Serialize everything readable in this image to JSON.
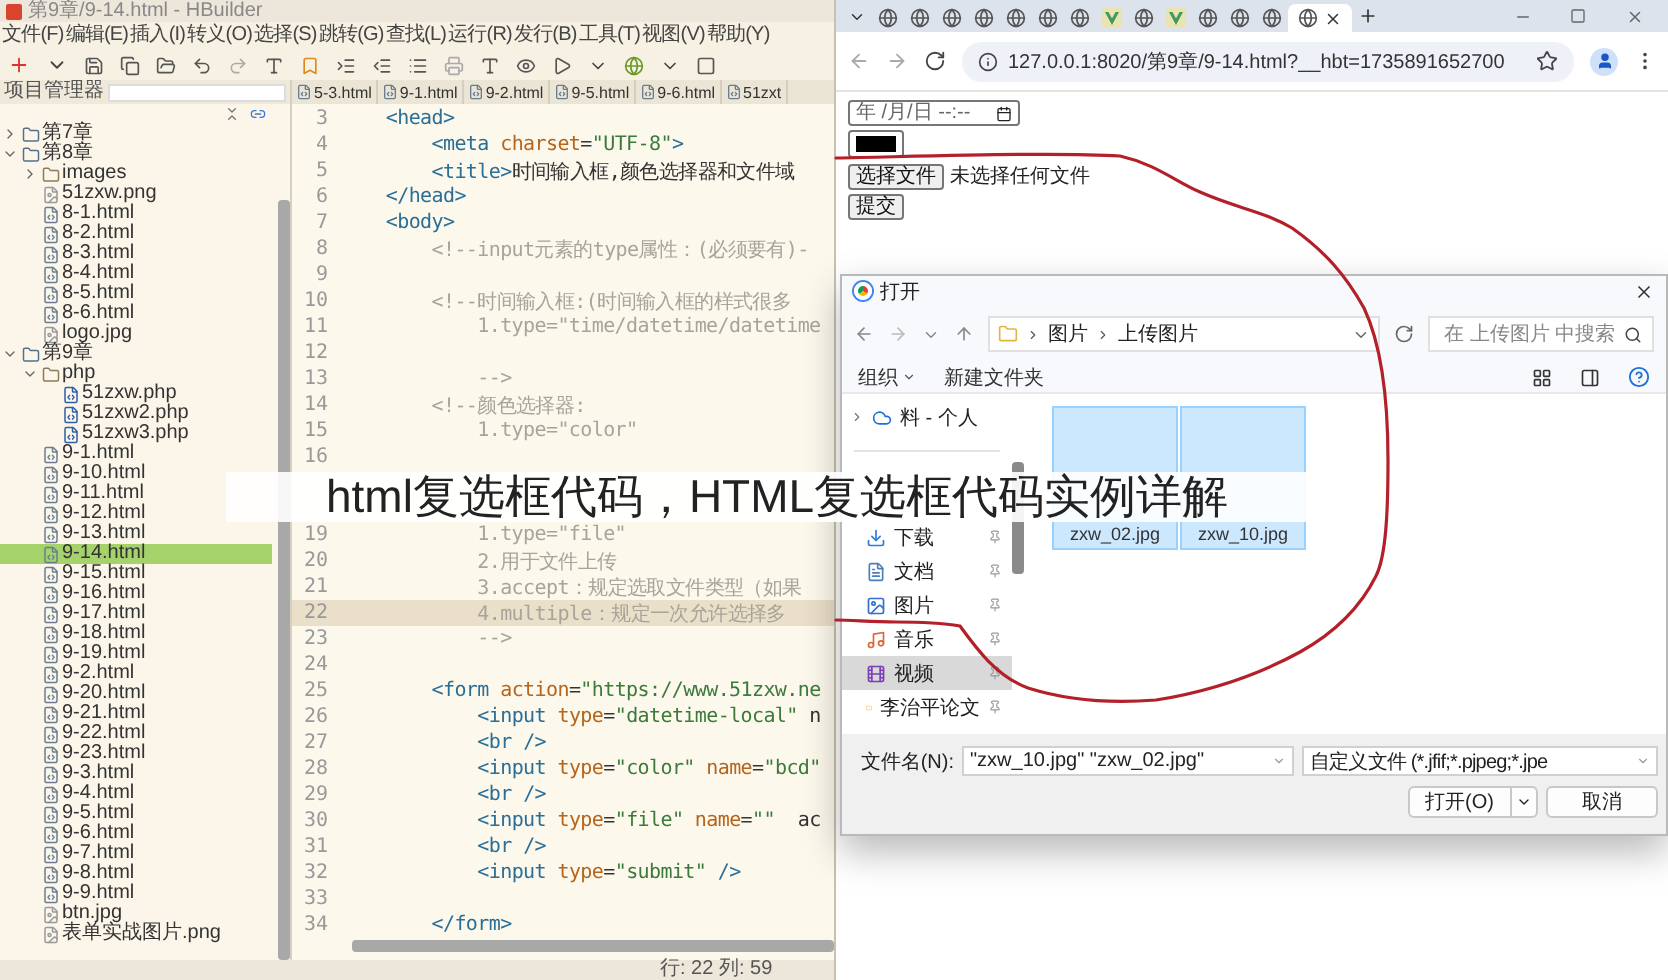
{
  "editor_window": {
    "title": "第9章/9-14.html - HBuilder",
    "menu": [
      "文件(F)",
      "编辑(E)",
      "插入(I)",
      "转义(O)",
      "选择(S)",
      "跳转(G)",
      "查找(L)",
      "运行(R)",
      "发行(B)",
      "工具(T)",
      "视图(V)",
      "帮助(Y)"
    ],
    "project_panel": {
      "title": "项目管理器",
      "tree": [
        {
          "label": "第7章",
          "kind": "chapter",
          "expanded": false,
          "selected": false
        },
        {
          "label": "第8章",
          "kind": "chapter",
          "expanded": true,
          "selected": false,
          "children": [
            {
              "label": "images",
              "kind": "folder",
              "expanded": false,
              "selected": false
            },
            {
              "label": "51zxw.png",
              "kind": "image",
              "selected": false
            },
            {
              "label": "8-1.html",
              "kind": "html",
              "selected": false
            },
            {
              "label": "8-2.html",
              "kind": "html",
              "selected": false
            },
            {
              "label": "8-3.html",
              "kind": "html",
              "selected": false
            },
            {
              "label": "8-4.html",
              "kind": "html",
              "selected": false
            },
            {
              "label": "8-5.html",
              "kind": "html",
              "selected": false
            },
            {
              "label": "8-6.html",
              "kind": "html",
              "selected": false
            },
            {
              "label": "logo.jpg",
              "kind": "image",
              "selected": false
            }
          ]
        },
        {
          "label": "第9章",
          "kind": "chapter",
          "expanded": true,
          "selected": false,
          "children": [
            {
              "label": "php",
              "kind": "folder",
              "expanded": true,
              "selected": false,
              "children": [
                {
                  "label": "51zxw.php",
                  "kind": "php",
                  "selected": false
                },
                {
                  "label": "51zxw2.php",
                  "kind": "php",
                  "selected": false
                },
                {
                  "label": "51zxw3.php",
                  "kind": "php",
                  "selected": false
                }
              ]
            },
            {
              "label": "9-1.html",
              "kind": "html",
              "selected": false
            },
            {
              "label": "9-10.html",
              "kind": "html",
              "selected": false
            },
            {
              "label": "9-11.html",
              "kind": "html",
              "selected": false
            },
            {
              "label": "9-12.html",
              "kind": "html",
              "selected": false
            },
            {
              "label": "9-13.html",
              "kind": "html",
              "selected": false
            },
            {
              "label": "9-14.html",
              "kind": "html",
              "selected": true
            },
            {
              "label": "9-15.html",
              "kind": "html",
              "selected": false
            },
            {
              "label": "9-16.html",
              "kind": "html",
              "selected": false
            },
            {
              "label": "9-17.html",
              "kind": "html",
              "selected": false
            },
            {
              "label": "9-18.html",
              "kind": "html",
              "selected": false
            },
            {
              "label": "9-19.html",
              "kind": "html",
              "selected": false
            },
            {
              "label": "9-2.html",
              "kind": "html",
              "selected": false
            },
            {
              "label": "9-20.html",
              "kind": "html",
              "selected": false
            },
            {
              "label": "9-21.html",
              "kind": "html",
              "selected": false
            },
            {
              "label": "9-22.html",
              "kind": "html",
              "selected": false
            },
            {
              "label": "9-23.html",
              "kind": "html",
              "selected": false
            },
            {
              "label": "9-3.html",
              "kind": "html",
              "selected": false
            },
            {
              "label": "9-4.html",
              "kind": "html",
              "selected": false
            },
            {
              "label": "9-5.html",
              "kind": "html",
              "selected": false
            },
            {
              "label": "9-6.html",
              "kind": "html",
              "selected": false
            },
            {
              "label": "9-7.html",
              "kind": "html",
              "selected": false
            },
            {
              "label": "9-8.html",
              "kind": "html",
              "selected": false
            },
            {
              "label": "9-9.html",
              "kind": "html",
              "selected": false
            },
            {
              "label": "btn.jpg",
              "kind": "image",
              "selected": false
            },
            {
              "label": "表单实战图片.png",
              "kind": "image",
              "selected": false
            }
          ]
        }
      ]
    },
    "editor_tabs": [
      "5-3.html",
      "9-1.html",
      "9-2.html",
      "9-5.html",
      "9-6.html",
      "51zxt"
    ],
    "code_lines": [
      {
        "number": "3",
        "kind": "markup",
        "text": "    <head>",
        "highlighted": false
      },
      {
        "number": "4",
        "kind": "markup",
        "text": "        <meta charset=\"UTF-8\">",
        "highlighted": false
      },
      {
        "number": "5",
        "kind": "markup",
        "text": "        <title>时间输入框,颜色选择器和文件域",
        "highlighted": false
      },
      {
        "number": "6",
        "kind": "markup",
        "text": "    </head>",
        "highlighted": false
      },
      {
        "number": "7",
        "kind": "markup",
        "text": "    <body>",
        "highlighted": false
      },
      {
        "number": "8",
        "kind": "comment",
        "text": "        <!--input元素的type属性：(必须要有)-",
        "highlighted": false
      },
      {
        "number": "9",
        "highlighted": false
      },
      {
        "number": "10",
        "kind": "comment",
        "text": "        <!--时间输入框:(时间输入框的样式很多",
        "highlighted": false
      },
      {
        "number": "11",
        "kind": "comment",
        "text": "            1.type=\"time/datetime/datetime",
        "highlighted": false
      },
      {
        "number": "12",
        "highlighted": false
      },
      {
        "number": "13",
        "kind": "comment",
        "text": "            -->",
        "highlighted": false
      },
      {
        "number": "14",
        "kind": "comment",
        "text": "        <!--颜色选择器:",
        "highlighted": false
      },
      {
        "number": "15",
        "kind": "comment",
        "text": "            1.type=\"color\"",
        "highlighted": false
      },
      {
        "number": "16",
        "highlighted": false
      },
      {
        "kind": "hidden"
      },
      {
        "kind": "hidden"
      },
      {
        "number": "19",
        "kind": "comment",
        "text": "            1.type=\"file\"",
        "highlighted": false
      },
      {
        "number": "20",
        "kind": "comment",
        "text": "            2.用于文件上传",
        "highlighted": false
      },
      {
        "number": "21",
        "kind": "comment",
        "text": "            3.accept：规定选取文件类型（如果",
        "highlighted": false
      },
      {
        "number": "22",
        "kind": "comment",
        "text": "            4.multiple：规定一次允许选择多",
        "highlighted": true
      },
      {
        "number": "23",
        "kind": "comment",
        "text": "            -->",
        "highlighted": false
      },
      {
        "number": "24",
        "highlighted": false
      },
      {
        "number": "25",
        "kind": "markup",
        "text": "        <form action=\"https://www.51zxw.ne",
        "highlighted": false
      },
      {
        "number": "26",
        "kind": "markup",
        "text": "            <input type=\"datetime-local\" n",
        "highlighted": false
      },
      {
        "number": "27",
        "kind": "markup",
        "text": "            <br />",
        "highlighted": false
      },
      {
        "number": "28",
        "kind": "markup",
        "text": "            <input type=\"color\" name=\"bcd\"",
        "highlighted": false
      },
      {
        "number": "29",
        "kind": "markup",
        "text": "            <br />",
        "highlighted": false
      },
      {
        "number": "30",
        "kind": "markup",
        "text": "            <input type=\"file\" name=\"\"  ac",
        "highlighted": false
      },
      {
        "number": "31",
        "kind": "markup",
        "text": "            <br />",
        "highlighted": false
      },
      {
        "number": "32",
        "kind": "markup",
        "text": "            <input type=\"submit\" />",
        "highlighted": false
      },
      {
        "number": "33",
        "highlighted": false
      },
      {
        "number": "34",
        "kind": "markup",
        "text": "        </form>",
        "highlighted": false
      }
    ],
    "status_bar": "行: 22 列: 59"
  },
  "browser": {
    "tabs": [
      {
        "kind": "globe",
        "selected": false
      },
      {
        "kind": "globe",
        "selected": false
      },
      {
        "kind": "globe",
        "selected": false
      },
      {
        "kind": "globe",
        "selected": false
      },
      {
        "kind": "globe",
        "selected": false
      },
      {
        "kind": "globe",
        "selected": false
      },
      {
        "kind": "globe",
        "selected": false
      },
      {
        "kind": "vue",
        "selected": false
      },
      {
        "kind": "globe",
        "selected": false
      },
      {
        "kind": "vue",
        "selected": false
      },
      {
        "kind": "globe",
        "selected": false
      },
      {
        "kind": "globe",
        "selected": false
      },
      {
        "kind": "globe",
        "selected": false
      },
      {
        "kind": "globe",
        "selected": true
      }
    ],
    "url": "127.0.0.1:8020/第9章/9-14.html?__hbt=1735891652700",
    "page": {
      "datetime_placeholder": "年 /月/日 --:--",
      "file_button": "选择文件",
      "file_status": "未选择任何文件",
      "submit_button": "提交"
    }
  },
  "open_dialog": {
    "title": "打开",
    "path": [
      "图片",
      "上传图片"
    ],
    "search_placeholder": "在 上传图片 中搜索",
    "commands": [
      "组织",
      "新建文件夹"
    ],
    "cloud_item": {
      "label": "料 - 个人",
      "expanded": false
    },
    "quick_access": [
      {
        "label": "下载",
        "kind": "downloads",
        "selected": false
      },
      {
        "label": "文档",
        "kind": "documents",
        "selected": false
      },
      {
        "label": "图片",
        "kind": "pictures",
        "selected": false
      },
      {
        "label": "音乐",
        "kind": "music",
        "selected": false
      },
      {
        "label": "视频",
        "kind": "videos",
        "selected": true
      },
      {
        "label": "李治平论文",
        "kind": "folder",
        "selected": false
      }
    ],
    "files": [
      {
        "name": "zxw_02.jpg",
        "selected": true
      },
      {
        "name": "zxw_10.jpg",
        "selected": true
      }
    ],
    "file_name_label": "文件名(N):",
    "file_name_value": "\"zxw_10.jpg\" \"zxw_02.jpg\"",
    "file_type": "自定义文件 (*.jfif;*.pjpeg;*.jpe",
    "buttons": [
      "打开(O)",
      "取消"
    ]
  },
  "overlay_title": "html复选框代码，HTML复选框代码实例详解"
}
